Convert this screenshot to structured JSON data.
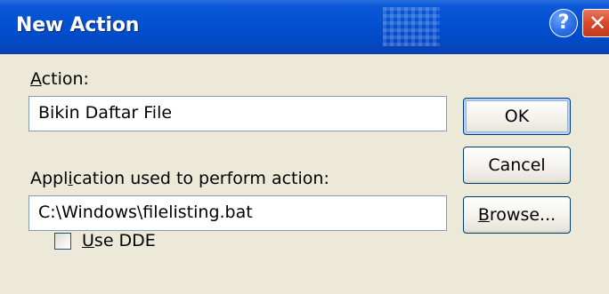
{
  "window": {
    "title": "New Action",
    "help_glyph": "?",
    "close_glyph": "✕"
  },
  "action": {
    "label_mnemonic": "A",
    "label_rest": "ction:",
    "value": "Bikin Daftar File"
  },
  "application": {
    "label_pre": "Appl",
    "label_mnemonic": "i",
    "label_rest": "cation used to perform action:",
    "value": "C:\\Windows\\filelisting.bat"
  },
  "buttons": {
    "ok_label": "OK",
    "cancel_label": "Cancel",
    "browse_mnemonic": "B",
    "browse_rest": "rowse..."
  },
  "dde": {
    "checked": false,
    "label_mnemonic": "U",
    "label_rest": "se DDE"
  },
  "colors": {
    "titlebar": "#0350d0",
    "face": "#ece9d8",
    "close_button": "#d9492a"
  },
  "icons": [
    "help-icon",
    "close-icon"
  ]
}
